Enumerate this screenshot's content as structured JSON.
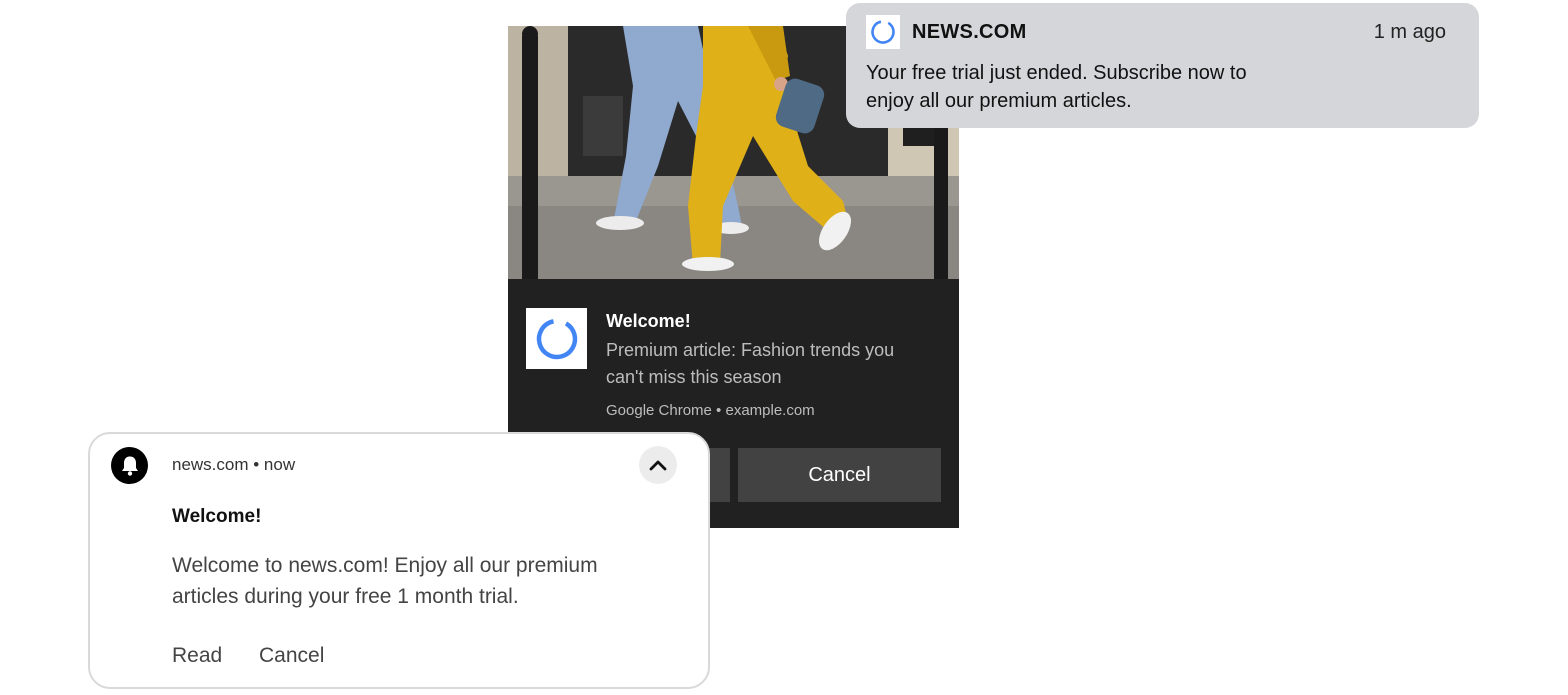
{
  "chrome_notification": {
    "title": "Welcome!",
    "body": "Premium article: Fashion trends you can't miss this season",
    "source": "Google Chrome • example.com",
    "actions": [
      "",
      "Cancel"
    ],
    "icon": "loading-ring-icon",
    "image": "fashion-photo-walking-figures"
  },
  "mac_notification": {
    "app_name": "NEWS.COM",
    "time": "1 m ago",
    "body": "Your free trial just ended. Subscribe now to enjoy all our premium articles.",
    "icon": "loading-ring-icon"
  },
  "android_notification": {
    "header": "news.com • now",
    "title": "Welcome!",
    "body": "Welcome to news.com! Enjoy all our premium articles during your free 1 month trial.",
    "actions": [
      "Read",
      "Cancel"
    ],
    "icon": "bell-icon",
    "expand_icon": "chevron-up-icon"
  },
  "colors": {
    "ring_blue": "#4285f4",
    "chrome_bg": "#212121",
    "mac_bg": "#d5d6d9"
  }
}
